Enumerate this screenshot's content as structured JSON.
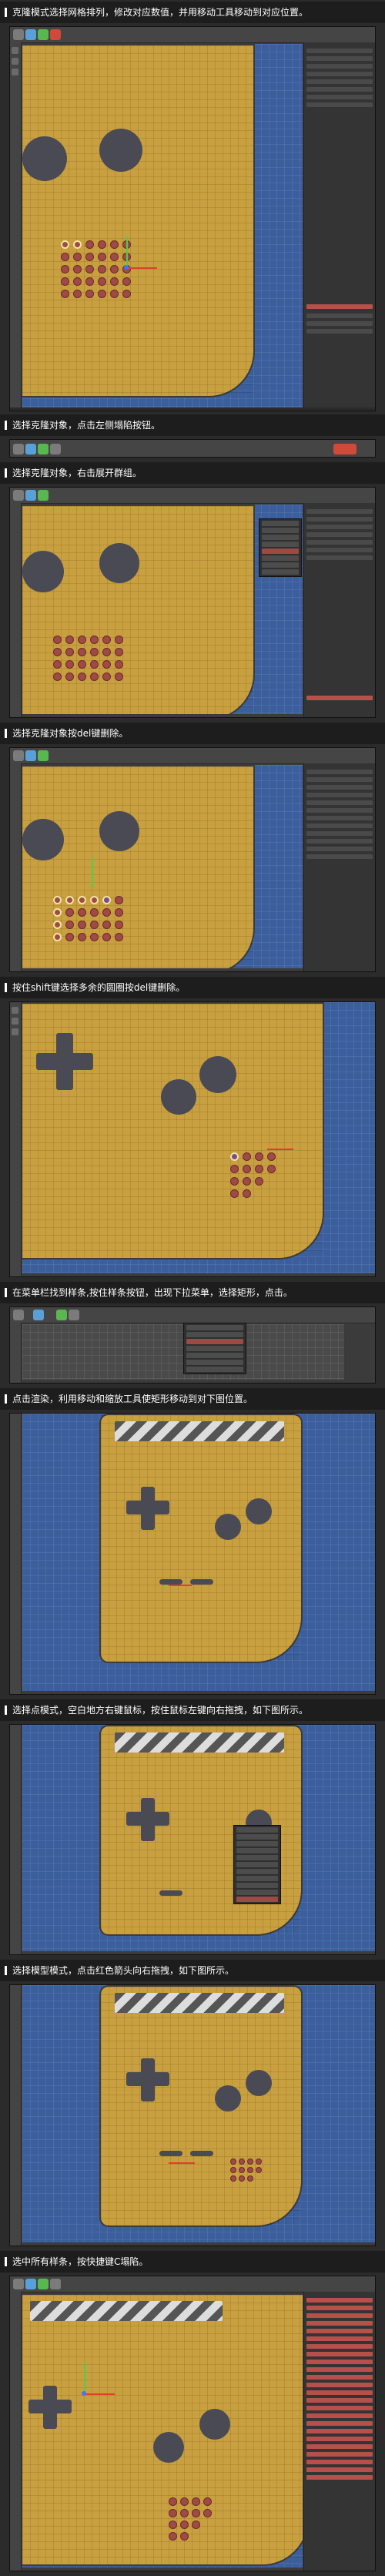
{
  "captions": [
    "克隆模式选择网格排列，修改对应数值，并用移动工具移动到对应位置。",
    "选择克隆对象，点击左侧塌陷按钮。",
    "选择克隆对象，右击展开群组。",
    "选择克隆对象按del键删除。",
    "按住shift键选择多余的圆圈按del键删除。",
    "在菜单栏找到样条,按住样条按钮，出现下拉菜单，选择矩形，点击。",
    "点击渲染，利用移动和缩放工具使矩形移动到对下图位置。",
    "选择点模式，空白地方右键鼠标，按住鼠标左键向右拖拽，如下图所示。",
    "选择模型模式，点击红色箭头向右拖拽，如下图所示。",
    "选中所有样条，按快捷键C塌陷。"
  ],
  "colors": {
    "body": "#c9a03f",
    "background": "#3b5e9c",
    "dots": "#a04a48",
    "panel": "#343434"
  }
}
